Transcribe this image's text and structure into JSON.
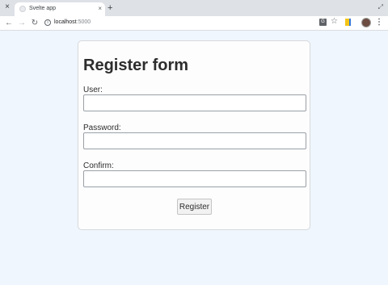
{
  "browser": {
    "tab_title": "Svelte app",
    "close_window_glyph": "×",
    "tab_close_glyph": "×",
    "new_tab_glyph": "+",
    "restore_glyph": "⤢",
    "url_host": "localhost",
    "url_port": ":5000",
    "icons": [
      "close-window-icon",
      "favicon-icon",
      "tab-close-icon",
      "new-tab-icon",
      "restore-icon",
      "back-icon",
      "forward-icon",
      "reload-icon",
      "info-icon",
      "translate-icon",
      "star-icon",
      "extension-icon",
      "avatar",
      "menu-icon"
    ]
  },
  "form": {
    "title": "Register form",
    "user_label": "User:",
    "password_label": "Password:",
    "confirm_label": "Confirm:",
    "user_value": "",
    "password_value": "",
    "confirm_value": "",
    "submit_label": "Register"
  },
  "colors": {
    "page_background": "#f0f6fd",
    "card_background": "#fdfdfe",
    "text": "#2d2d2d"
  }
}
